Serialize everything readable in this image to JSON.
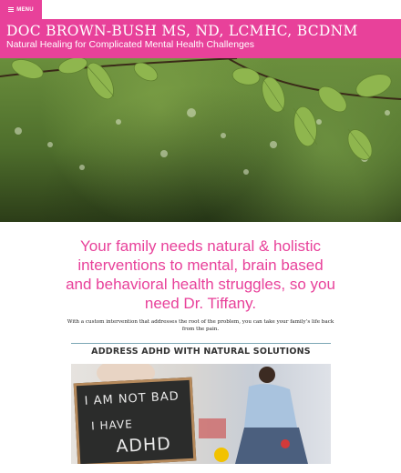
{
  "nav": {
    "menu_label": "MENU",
    "menu_icon": "hamburger-icon"
  },
  "header": {
    "site_title": "DOC BROWN-BUSH MS, ND, LCMHC, BCDNM",
    "tagline": "Natural Healing for Complicated Mental Health Challenges",
    "brand_color": "#e8419a"
  },
  "hero": {
    "image": "green-leaves-photo"
  },
  "main": {
    "headline": "Your family needs natural & holistic interventions to mental, brain based and behavioral health struggles, so you need Dr. Tiffany.",
    "subtext": "With a custom intervention that addresses the root of the problem, you can take your family’s life back from the pain.",
    "section_heading": "ADDRESS ADHD WITH NATURAL SOLUTIONS",
    "photo": {
      "chalkboard_lines": [
        "I AM NOT BAD",
        "I HAVE",
        "ADHD"
      ]
    }
  }
}
